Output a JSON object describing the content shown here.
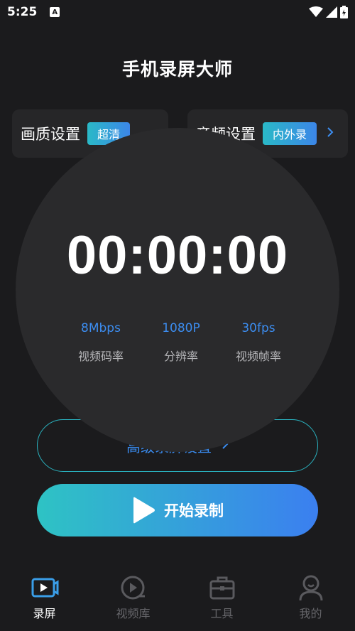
{
  "status_bar": {
    "time": "5:25",
    "notification_glyph": "A"
  },
  "app": {
    "title": "手机录屏大师"
  },
  "settings": {
    "quality": {
      "label": "画质设置",
      "value": "超清"
    },
    "audio": {
      "label": "音频设置",
      "value": "内外录"
    }
  },
  "timer": {
    "time": "00:00:00"
  },
  "stats": [
    {
      "value": "8Mbps",
      "label": "视频码率"
    },
    {
      "value": "1080P",
      "label": "分辨率"
    },
    {
      "value": "30fps",
      "label": "视频帧率"
    }
  ],
  "advanced": {
    "label": "高级录屏设置"
  },
  "start": {
    "label": "开始录制"
  },
  "nav": [
    {
      "label": "录屏",
      "icon": "record-icon",
      "active": true
    },
    {
      "label": "视频库",
      "icon": "video-library-icon",
      "active": false
    },
    {
      "label": "工具",
      "icon": "toolbox-icon",
      "active": false
    },
    {
      "label": "我的",
      "icon": "profile-icon",
      "active": false
    }
  ],
  "colors": {
    "background": "#1b1b1d",
    "accent_blue": "#3c8df0",
    "accent_teal": "#2ec3c4",
    "card": "#262628"
  }
}
